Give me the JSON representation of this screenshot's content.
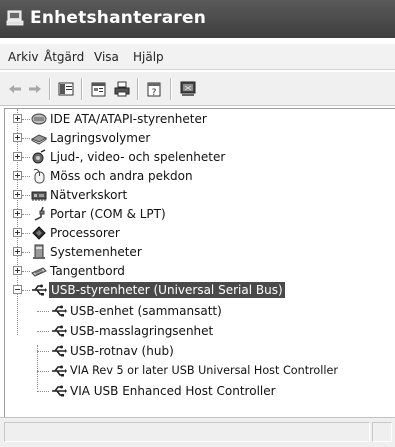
{
  "window": {
    "title": "Enhetshanteraren"
  },
  "menubar": {
    "items": [
      {
        "label": "Arkiv"
      },
      {
        "label": "Åtgärd"
      },
      {
        "label": "Visa"
      },
      {
        "label": "Hjälp"
      }
    ]
  },
  "toolbar": {
    "buttons": [
      "back-arrow-icon",
      "forward-arrow-icon",
      "show-hide-tree-icon",
      "properties-icon",
      "print-icon",
      "help-icon",
      "scan-hardware-icon"
    ]
  },
  "tree": {
    "categories": [
      {
        "label": "IDE ATA/ATAPI-styrenheter",
        "icon": "ide-controller-icon",
        "expanded": false
      },
      {
        "label": "Lagringsvolymer",
        "icon": "storage-volume-icon",
        "expanded": false
      },
      {
        "label": "Ljud-, video- och spelenheter",
        "icon": "sound-device-icon",
        "expanded": false
      },
      {
        "label": "Möss och andra pekdon",
        "icon": "mouse-icon",
        "expanded": false
      },
      {
        "label": "Nätverkskort",
        "icon": "network-adapter-icon",
        "expanded": false
      },
      {
        "label": "Portar (COM & LPT)",
        "icon": "port-icon",
        "expanded": false
      },
      {
        "label": "Processorer",
        "icon": "processor-icon",
        "expanded": false
      },
      {
        "label": "Systemenheter",
        "icon": "system-device-icon",
        "expanded": false
      },
      {
        "label": "Tangentbord",
        "icon": "keyboard-icon",
        "expanded": false
      },
      {
        "label": "USB-styrenheter (Universal Serial Bus)",
        "icon": "usb-icon",
        "expanded": true,
        "selected": true,
        "children": [
          {
            "label": "USB-enhet (sammansatt)",
            "icon": "usb-icon"
          },
          {
            "label": "USB-masslagringsenhet",
            "icon": "usb-icon"
          },
          {
            "label": "USB-rotnav (hub)",
            "icon": "usb-icon"
          },
          {
            "label": "VIA Rev 5 or later USB Universal Host Controller",
            "icon": "usb-icon"
          },
          {
            "label": "VIA USB Enhanced Host Controller",
            "icon": "usb-icon"
          }
        ]
      }
    ]
  },
  "colors": {
    "titlebar": "#4a4a4a",
    "selection": "#4a4a4a"
  }
}
